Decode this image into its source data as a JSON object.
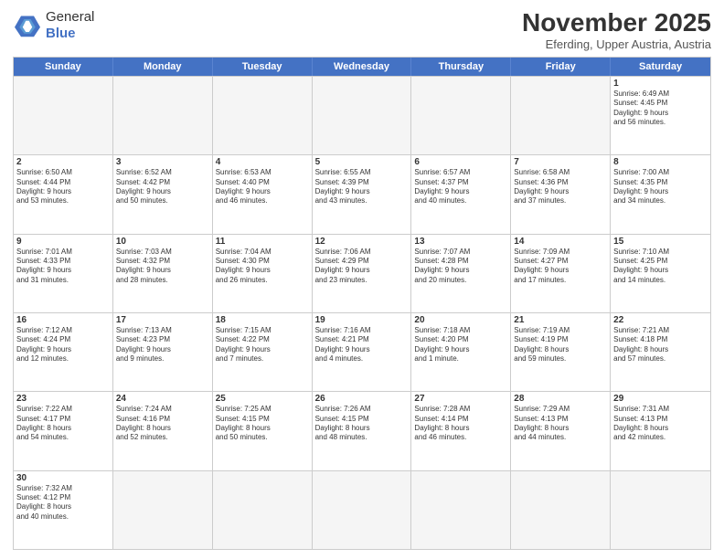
{
  "logo": {
    "text_general": "General",
    "text_blue": "Blue"
  },
  "title": "November 2025",
  "subtitle": "Eferding, Upper Austria, Austria",
  "header_days": [
    "Sunday",
    "Monday",
    "Tuesday",
    "Wednesday",
    "Thursday",
    "Friday",
    "Saturday"
  ],
  "weeks": [
    [
      {
        "day": "",
        "info": "",
        "empty": true
      },
      {
        "day": "",
        "info": "",
        "empty": true
      },
      {
        "day": "",
        "info": "",
        "empty": true
      },
      {
        "day": "",
        "info": "",
        "empty": true
      },
      {
        "day": "",
        "info": "",
        "empty": true
      },
      {
        "day": "",
        "info": "",
        "empty": true
      },
      {
        "day": "1",
        "info": "Sunrise: 6:49 AM\nSunset: 4:45 PM\nDaylight: 9 hours\nand 56 minutes.",
        "empty": false
      }
    ],
    [
      {
        "day": "2",
        "info": "Sunrise: 6:50 AM\nSunset: 4:44 PM\nDaylight: 9 hours\nand 53 minutes.",
        "empty": false
      },
      {
        "day": "3",
        "info": "Sunrise: 6:52 AM\nSunset: 4:42 PM\nDaylight: 9 hours\nand 50 minutes.",
        "empty": false
      },
      {
        "day": "4",
        "info": "Sunrise: 6:53 AM\nSunset: 4:40 PM\nDaylight: 9 hours\nand 46 minutes.",
        "empty": false
      },
      {
        "day": "5",
        "info": "Sunrise: 6:55 AM\nSunset: 4:39 PM\nDaylight: 9 hours\nand 43 minutes.",
        "empty": false
      },
      {
        "day": "6",
        "info": "Sunrise: 6:57 AM\nSunset: 4:37 PM\nDaylight: 9 hours\nand 40 minutes.",
        "empty": false
      },
      {
        "day": "7",
        "info": "Sunrise: 6:58 AM\nSunset: 4:36 PM\nDaylight: 9 hours\nand 37 minutes.",
        "empty": false
      },
      {
        "day": "8",
        "info": "Sunrise: 7:00 AM\nSunset: 4:35 PM\nDaylight: 9 hours\nand 34 minutes.",
        "empty": false
      }
    ],
    [
      {
        "day": "9",
        "info": "Sunrise: 7:01 AM\nSunset: 4:33 PM\nDaylight: 9 hours\nand 31 minutes.",
        "empty": false
      },
      {
        "day": "10",
        "info": "Sunrise: 7:03 AM\nSunset: 4:32 PM\nDaylight: 9 hours\nand 28 minutes.",
        "empty": false
      },
      {
        "day": "11",
        "info": "Sunrise: 7:04 AM\nSunset: 4:30 PM\nDaylight: 9 hours\nand 26 minutes.",
        "empty": false
      },
      {
        "day": "12",
        "info": "Sunrise: 7:06 AM\nSunset: 4:29 PM\nDaylight: 9 hours\nand 23 minutes.",
        "empty": false
      },
      {
        "day": "13",
        "info": "Sunrise: 7:07 AM\nSunset: 4:28 PM\nDaylight: 9 hours\nand 20 minutes.",
        "empty": false
      },
      {
        "day": "14",
        "info": "Sunrise: 7:09 AM\nSunset: 4:27 PM\nDaylight: 9 hours\nand 17 minutes.",
        "empty": false
      },
      {
        "day": "15",
        "info": "Sunrise: 7:10 AM\nSunset: 4:25 PM\nDaylight: 9 hours\nand 14 minutes.",
        "empty": false
      }
    ],
    [
      {
        "day": "16",
        "info": "Sunrise: 7:12 AM\nSunset: 4:24 PM\nDaylight: 9 hours\nand 12 minutes.",
        "empty": false
      },
      {
        "day": "17",
        "info": "Sunrise: 7:13 AM\nSunset: 4:23 PM\nDaylight: 9 hours\nand 9 minutes.",
        "empty": false
      },
      {
        "day": "18",
        "info": "Sunrise: 7:15 AM\nSunset: 4:22 PM\nDaylight: 9 hours\nand 7 minutes.",
        "empty": false
      },
      {
        "day": "19",
        "info": "Sunrise: 7:16 AM\nSunset: 4:21 PM\nDaylight: 9 hours\nand 4 minutes.",
        "empty": false
      },
      {
        "day": "20",
        "info": "Sunrise: 7:18 AM\nSunset: 4:20 PM\nDaylight: 9 hours\nand 1 minute.",
        "empty": false
      },
      {
        "day": "21",
        "info": "Sunrise: 7:19 AM\nSunset: 4:19 PM\nDaylight: 8 hours\nand 59 minutes.",
        "empty": false
      },
      {
        "day": "22",
        "info": "Sunrise: 7:21 AM\nSunset: 4:18 PM\nDaylight: 8 hours\nand 57 minutes.",
        "empty": false
      }
    ],
    [
      {
        "day": "23",
        "info": "Sunrise: 7:22 AM\nSunset: 4:17 PM\nDaylight: 8 hours\nand 54 minutes.",
        "empty": false
      },
      {
        "day": "24",
        "info": "Sunrise: 7:24 AM\nSunset: 4:16 PM\nDaylight: 8 hours\nand 52 minutes.",
        "empty": false
      },
      {
        "day": "25",
        "info": "Sunrise: 7:25 AM\nSunset: 4:15 PM\nDaylight: 8 hours\nand 50 minutes.",
        "empty": false
      },
      {
        "day": "26",
        "info": "Sunrise: 7:26 AM\nSunset: 4:15 PM\nDaylight: 8 hours\nand 48 minutes.",
        "empty": false
      },
      {
        "day": "27",
        "info": "Sunrise: 7:28 AM\nSunset: 4:14 PM\nDaylight: 8 hours\nand 46 minutes.",
        "empty": false
      },
      {
        "day": "28",
        "info": "Sunrise: 7:29 AM\nSunset: 4:13 PM\nDaylight: 8 hours\nand 44 minutes.",
        "empty": false
      },
      {
        "day": "29",
        "info": "Sunrise: 7:31 AM\nSunset: 4:13 PM\nDaylight: 8 hours\nand 42 minutes.",
        "empty": false
      }
    ],
    [
      {
        "day": "30",
        "info": "Sunrise: 7:32 AM\nSunset: 4:12 PM\nDaylight: 8 hours\nand 40 minutes.",
        "empty": false
      },
      {
        "day": "",
        "info": "",
        "empty": true
      },
      {
        "day": "",
        "info": "",
        "empty": true
      },
      {
        "day": "",
        "info": "",
        "empty": true
      },
      {
        "day": "",
        "info": "",
        "empty": true
      },
      {
        "day": "",
        "info": "",
        "empty": true
      },
      {
        "day": "",
        "info": "",
        "empty": true
      }
    ]
  ]
}
